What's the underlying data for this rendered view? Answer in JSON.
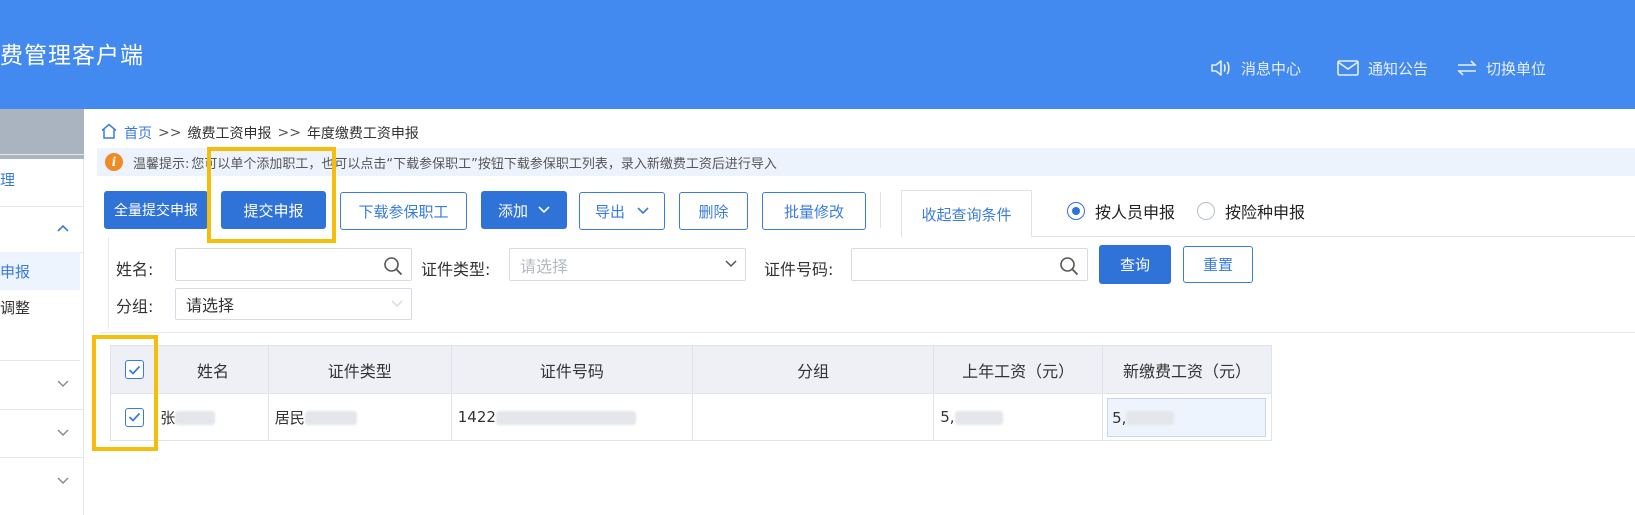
{
  "header": {
    "app_title": "费管理客户端",
    "links": {
      "messages": "消息中心",
      "notices": "通知公告",
      "switch_unit": "切换单位"
    }
  },
  "sidebar": {
    "items": [
      "理",
      "申报",
      "调整"
    ]
  },
  "breadcrumb": {
    "home": "首页",
    "sep": ">>",
    "level1": "缴费工资申报",
    "level2": "年度缴费工资申报"
  },
  "tip": {
    "label": "温馨提示:",
    "text": "您可以单个添加职工，也可以点击“下载参保职工”按钮下载参保职工列表，录入新缴费工资后进行导入"
  },
  "toolbar": {
    "submit_all": "全量提交申报",
    "submit": "提交申报",
    "download": "下载参保职工",
    "add": "添加",
    "export": "导出",
    "delete": "删除",
    "batch_edit": "批量修改",
    "collapse_query": "收起查询条件",
    "radio_by_person": "按人员申报",
    "radio_by_insurance": "按险种申报",
    "selected_radio": "按人员申报"
  },
  "filters": {
    "name_label": "姓名:",
    "id_type_label": "证件类型:",
    "id_type_placeholder": "请选择",
    "id_no_label": "证件号码:",
    "group_label": "分组:",
    "group_value": "请选择",
    "query": "查询",
    "reset": "重置"
  },
  "table": {
    "columns": [
      "姓名",
      "证件类型",
      "证件号码",
      "分组",
      "上年工资（元）",
      "新缴费工资（元）"
    ],
    "rows": [
      {
        "checked": true,
        "name": "张",
        "id_type": "居民",
        "id_no": "1422",
        "group": "",
        "last_salary": "5,",
        "new_salary": "5,"
      }
    ],
    "header_checked": true
  },
  "colors": {
    "header_bg": "#4289f0",
    "primary": "#2f72d8",
    "highlight": "#f5bd0c",
    "tip_icon": "#f08a24"
  }
}
